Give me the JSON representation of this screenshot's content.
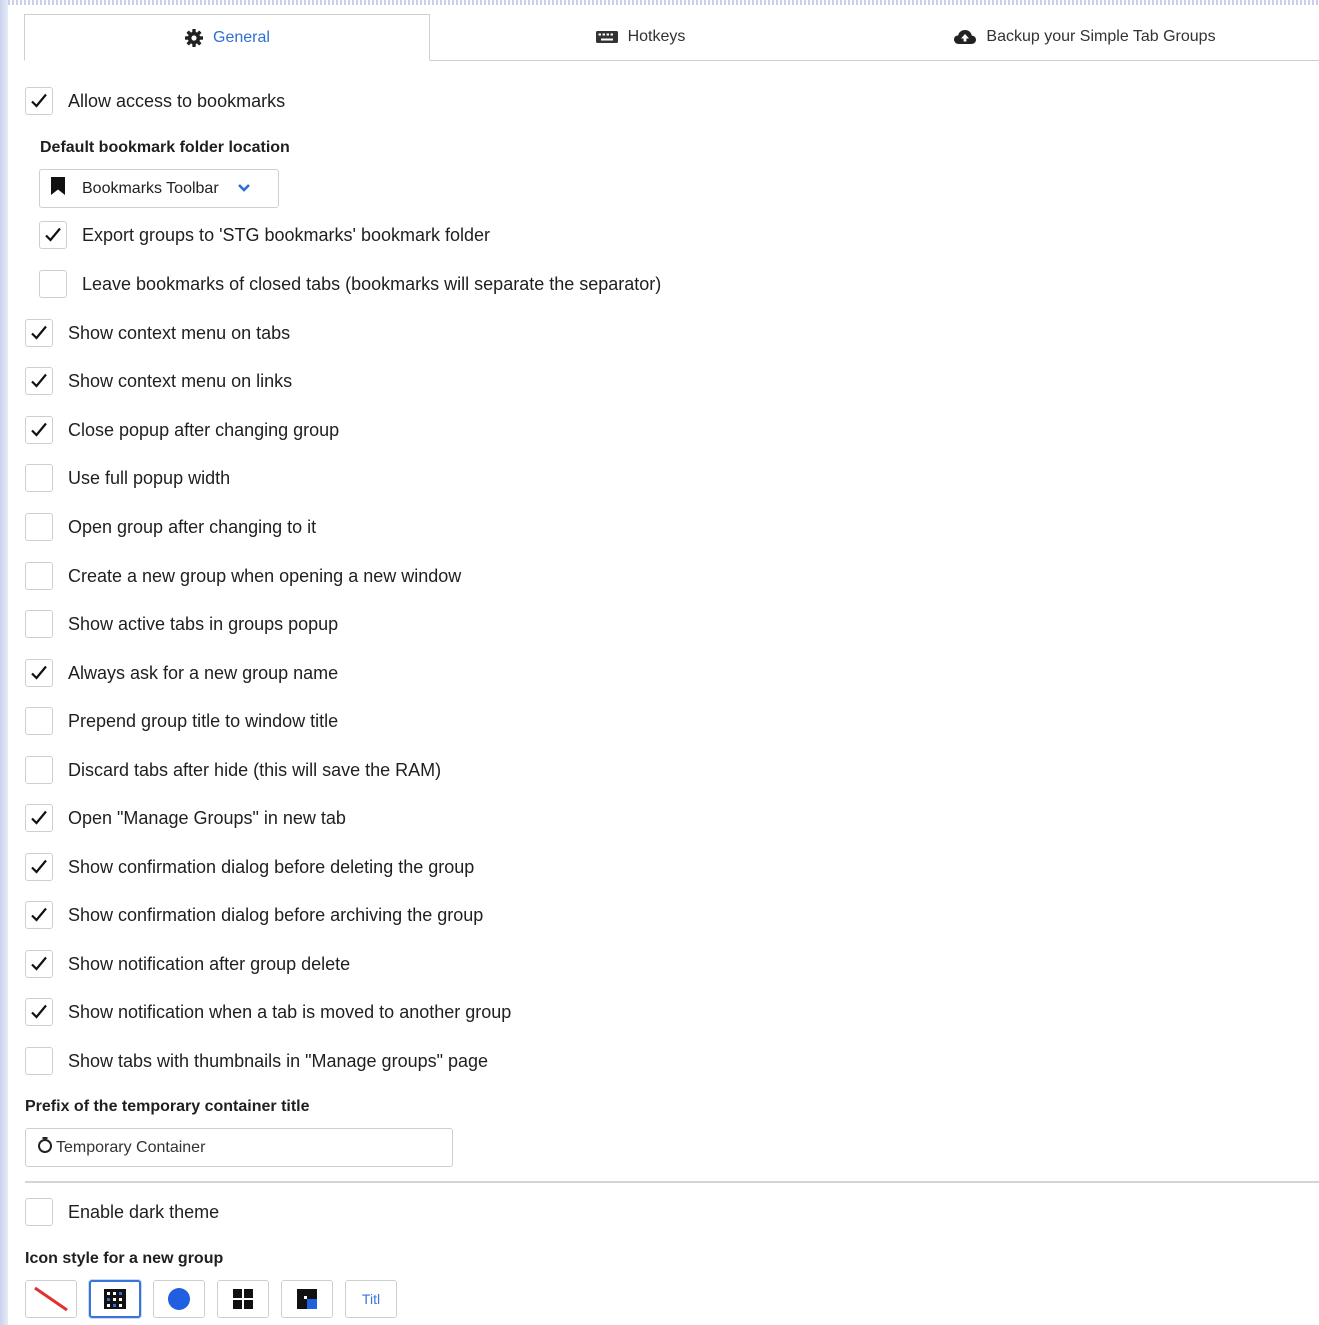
{
  "tabs": [
    {
      "label": "General",
      "icon": "gear-icon",
      "active": true
    },
    {
      "label": "Hotkeys",
      "icon": "keyboard-icon",
      "active": false
    },
    {
      "label": "Backup your Simple Tab Groups",
      "icon": "cloud-upload-icon",
      "active": false
    }
  ],
  "options": {
    "allow_bookmarks": {
      "label": "Allow access to bookmarks",
      "checked": true
    },
    "bookmark_folder_label": "Default bookmark folder location",
    "bookmark_folder_select": {
      "value": "Bookmarks Toolbar",
      "icon": "bookmark-icon"
    },
    "export_groups": {
      "label": "Export groups to 'STG bookmarks' bookmark folder",
      "checked": true
    },
    "leave_bookmarks": {
      "label": "Leave bookmarks of closed tabs (bookmarks will separate the separator)",
      "checked": false
    },
    "context_menu_tabs": {
      "label": "Show context menu on tabs",
      "checked": true
    },
    "context_menu_links": {
      "label": "Show context menu on links",
      "checked": true
    },
    "close_popup": {
      "label": "Close popup after changing group",
      "checked": true
    },
    "full_popup_width": {
      "label": "Use full popup width",
      "checked": false
    },
    "open_group_after": {
      "label": "Open group after changing to it",
      "checked": false
    },
    "new_group_new_window": {
      "label": "Create a new group when opening a new window",
      "checked": false
    },
    "active_tabs_popup": {
      "label": "Show active tabs in groups popup",
      "checked": false
    },
    "ask_group_name": {
      "label": "Always ask for a new group name",
      "checked": true
    },
    "prepend_title": {
      "label": "Prepend group title to window title",
      "checked": false
    },
    "discard_tabs": {
      "label": "Discard tabs after hide (this will save the RAM)",
      "checked": false
    },
    "manage_groups_new_tab": {
      "label": "Open \"Manage Groups\" in new tab",
      "checked": true
    },
    "confirm_delete": {
      "label": "Show confirmation dialog before deleting the group",
      "checked": true
    },
    "confirm_archive": {
      "label": "Show confirmation dialog before archiving the group",
      "checked": true
    },
    "notify_delete": {
      "label": "Show notification after group delete",
      "checked": true
    },
    "notify_moved": {
      "label": "Show notification when a tab is moved to another group",
      "checked": true
    },
    "thumbnails": {
      "label": "Show tabs with thumbnails in \"Manage groups\" page",
      "checked": false
    },
    "container_prefix_label": "Prefix of the temporary container title",
    "container_prefix_value": "Temporary Container",
    "dark_theme": {
      "label": "Enable dark theme",
      "checked": false
    },
    "icon_style_label": "Icon style for a new group",
    "icon_styles": [
      {
        "name": "none-icon-style",
        "selected": false
      },
      {
        "name": "squares-icon-style",
        "selected": true
      },
      {
        "name": "circle-icon-style",
        "selected": false
      },
      {
        "name": "grid-icon-style",
        "selected": false
      },
      {
        "name": "blocks-icon-style",
        "selected": false
      },
      {
        "name": "title-icon-style",
        "label": "Titl",
        "selected": false
      }
    ]
  },
  "colors": {
    "accent": "#2f6fd4",
    "border": "#cfcfcf"
  }
}
